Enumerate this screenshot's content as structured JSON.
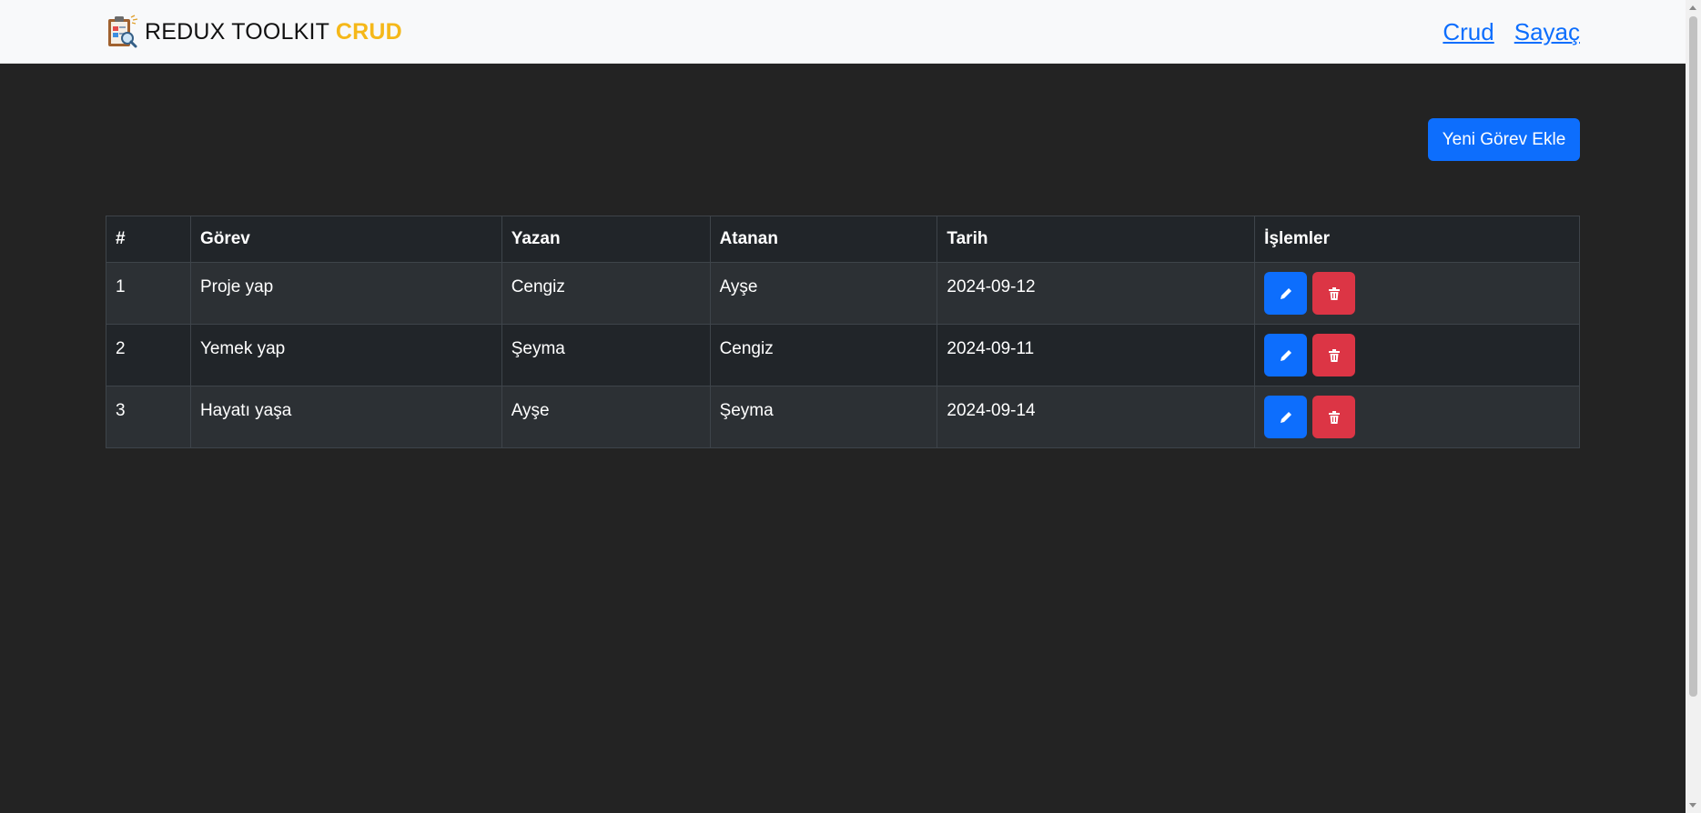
{
  "navbar": {
    "brand_text": "REDUX TOOLKIT",
    "brand_accent": "CRUD",
    "logo_icon": "clipboard-magnifier-logo",
    "links": [
      {
        "label": "Crud"
      },
      {
        "label": "Sayaç"
      }
    ]
  },
  "toolbar": {
    "add_label": "Yeni Görev Ekle"
  },
  "table": {
    "headers": {
      "index": "#",
      "task": "Görev",
      "author": "Yazan",
      "assignee": "Atanan",
      "date": "Tarih",
      "actions": "İşlemler"
    },
    "rows": [
      {
        "index": "1",
        "task": "Proje yap",
        "author": "Cengiz",
        "assignee": "Ayşe",
        "date": "2024-09-12"
      },
      {
        "index": "2",
        "task": "Yemek yap",
        "author": "Şeyma",
        "assignee": "Cengiz",
        "date": "2024-09-11"
      },
      {
        "index": "3",
        "task": "Hayatı yaşa",
        "author": "Ayşe",
        "assignee": "Şeyma",
        "date": "2024-09-14"
      }
    ],
    "row_actions": {
      "edit_icon": "pencil-icon",
      "delete_icon": "trash-icon"
    }
  },
  "colors": {
    "page_background": "#232323",
    "navbar_background": "#f8f9fa",
    "brand_accent": "#f5b819",
    "primary": "#0d6efd",
    "danger": "#dc3545",
    "table_dark": "#212529",
    "table_striped": "#2c3034"
  }
}
